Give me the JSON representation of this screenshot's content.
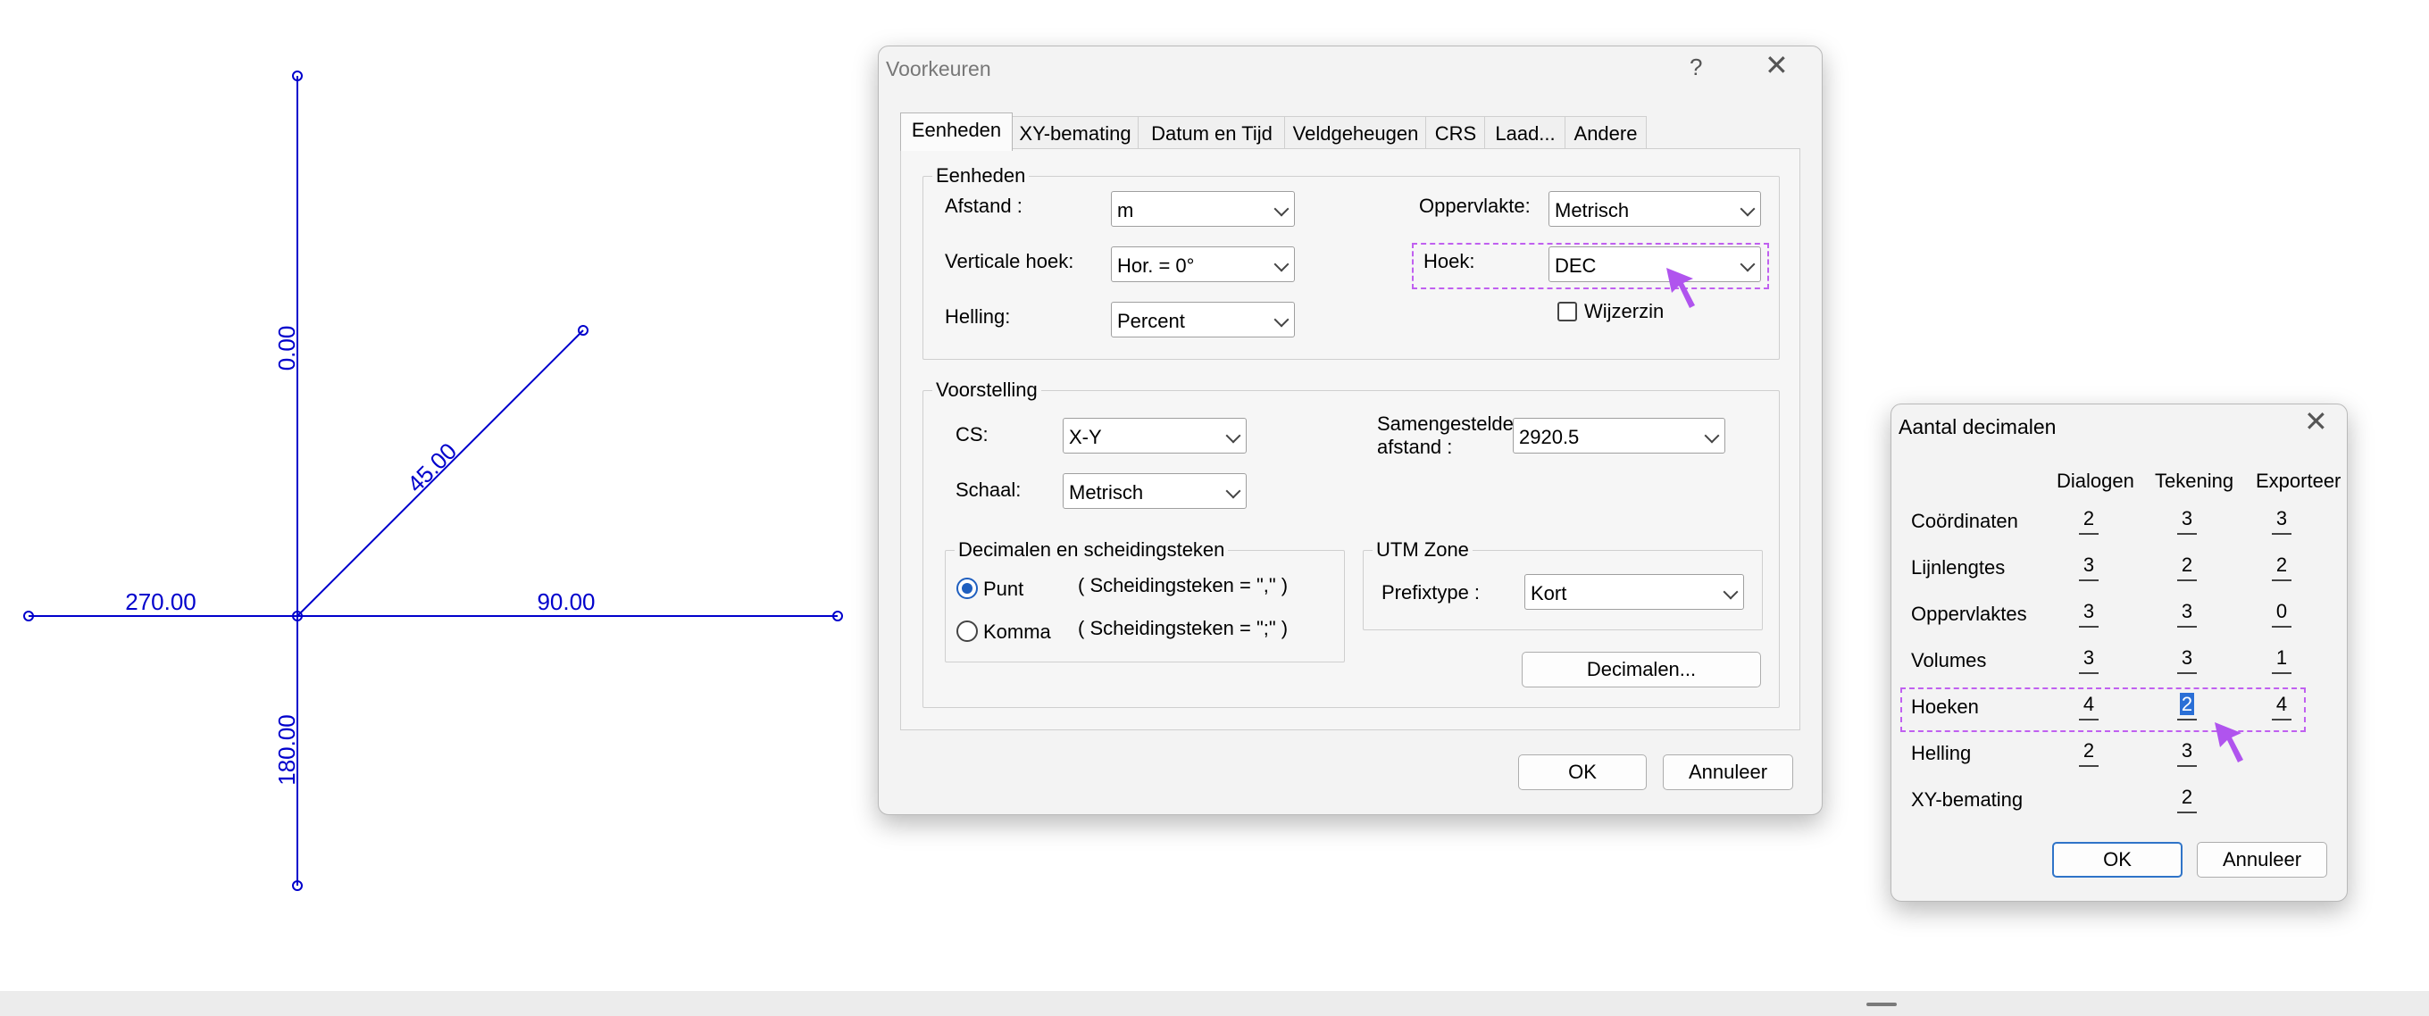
{
  "drawing": {
    "labels": {
      "north": "0.00",
      "northeast": "45.00",
      "east": "90.00",
      "south": "180.00",
      "west": "270.00"
    },
    "line_color": "#0000cc"
  },
  "voorkeuren": {
    "title": "Voorkeuren",
    "help_glyph": "?",
    "close_glyph": "✕",
    "tabs": [
      "Eenheden",
      "XY-bemating",
      "Datum en Tijd",
      "Veldgeheugen",
      "CRS",
      "Laad...",
      "Andere"
    ],
    "active_tab": "Eenheden",
    "eenheden": {
      "group_title": "Eenheden",
      "afstand_label": "Afstand :",
      "afstand_value": "m",
      "verticale_hoek_label": "Verticale hoek:",
      "verticale_hoek_value": "Hor. = 0°",
      "helling_label": "Helling:",
      "helling_value": "Percent",
      "oppervlakte_label": "Oppervlakte:",
      "oppervlakte_value": "Metrisch",
      "hoek_label": "Hoek:",
      "hoek_value": "DEC",
      "wijzerzin_label": "Wijzerzin",
      "wijzerzin_checked": false
    },
    "voorstelling": {
      "group_title": "Voorstelling",
      "cs_label": "CS:",
      "cs_value": "X-Y",
      "schaal_label": "Schaal:",
      "schaal_value": "Metrisch",
      "samengestelde_label_1": "Samengestelde",
      "samengestelde_label_2": "afstand :",
      "samengestelde_value": "2920.5",
      "decimalen_group_title": "Decimalen en scheidingsteken",
      "punt_label": "Punt",
      "punt_hint": "( Scheidingsteken = \",\" )",
      "komma_label": "Komma",
      "komma_hint": "( Scheidingsteken = \";\" )",
      "selected_separator": "Punt",
      "utm_group_title": "UTM Zone",
      "prefixtype_label": "Prefixtype :",
      "prefixtype_value": "Kort",
      "decimalen_button": "Decimalen..."
    },
    "ok_label": "OK",
    "annuleer_label": "Annuleer"
  },
  "aantal_decimalen": {
    "title": "Aantal decimalen",
    "close_glyph": "✕",
    "columns": [
      "Dialogen",
      "Tekening",
      "Exporteer"
    ],
    "rows": [
      {
        "label": "Coördinaten",
        "values": [
          "2",
          "3",
          "3"
        ]
      },
      {
        "label": "Lijnlengtes",
        "values": [
          "3",
          "2",
          "2"
        ]
      },
      {
        "label": "Oppervlaktes",
        "values": [
          "3",
          "3",
          "0"
        ]
      },
      {
        "label": "Volumes",
        "values": [
          "3",
          "3",
          "1"
        ]
      },
      {
        "label": "Hoeken",
        "values": [
          "4",
          "2",
          "4"
        ]
      },
      {
        "label": "Helling",
        "values": [
          "2",
          "3",
          ""
        ]
      },
      {
        "label": "XY-bemating",
        "values": [
          "",
          "2",
          ""
        ]
      }
    ],
    "ok_label": "OK",
    "annuleer_label": "Annuleer"
  },
  "highlight_color": "#c060f0"
}
